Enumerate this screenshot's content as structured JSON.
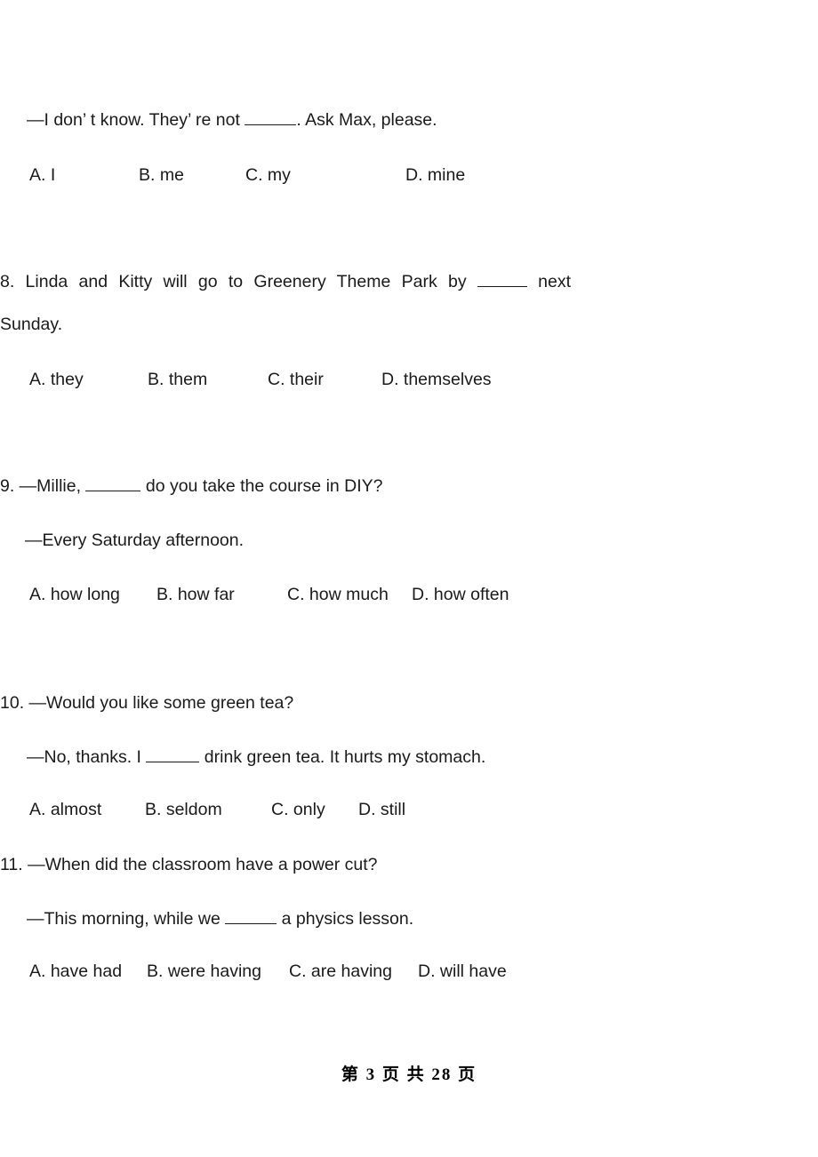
{
  "document": {
    "page_label": "第 3 页 共 28 页",
    "page_number": "3",
    "total_pages": "28",
    "text_color": "#1a1a1a"
  },
  "questions": [
    {
      "id": "q7-continuation",
      "stem_line_1": "—I don’ t know. They’ re not ",
      "stem_line_1_tail": ". Ask Max, please.",
      "options": [
        {
          "key": "A",
          "label": "A. I"
        },
        {
          "key": "B",
          "label": "B. me"
        },
        {
          "key": "C",
          "label": "C. my"
        },
        {
          "key": "D",
          "label": "D. mine"
        }
      ]
    },
    {
      "id": "q8",
      "number": "8.",
      "stem_line_1": "8. Linda and Kitty will go to Greenery Theme Park by ",
      "stem_line_1_tail": " next",
      "stem_line_2": "Sunday.",
      "options": [
        {
          "key": "A",
          "label": "A. they"
        },
        {
          "key": "B",
          "label": "B. them"
        },
        {
          "key": "C",
          "label": "C. their"
        },
        {
          "key": "D",
          "label": "D. themselves"
        }
      ]
    },
    {
      "id": "q9",
      "number": "9.",
      "stem_line_1": "9. —Millie, ",
      "stem_line_1_tail": " do you take the course in DIY?",
      "stem_line_2": "—Every Saturday afternoon.",
      "options": [
        {
          "key": "A",
          "label": "A. how long"
        },
        {
          "key": "B",
          "label": "B. how far"
        },
        {
          "key": "C",
          "label": "C. how much"
        },
        {
          "key": "D",
          "label": "D. how often"
        }
      ]
    },
    {
      "id": "q10",
      "number": "10.",
      "stem_line_1": "10. —Would you like some green tea?",
      "stem_line_2_head": "—No, thanks. I ",
      "stem_line_2_tail": " drink green tea. It hurts my stomach.",
      "options": [
        {
          "key": "A",
          "label": "A. almost"
        },
        {
          "key": "B",
          "label": "B. seldom"
        },
        {
          "key": "C",
          "label": "C. only"
        },
        {
          "key": "D",
          "label": "D. still"
        }
      ]
    },
    {
      "id": "q11",
      "number": "11.",
      "stem_line_1": "11. —When did the classroom have a power cut?",
      "stem_line_2_head": "—This morning, while we ",
      "stem_line_2_tail": " a physics lesson.",
      "options": [
        {
          "key": "A",
          "label": "A. have had"
        },
        {
          "key": "B",
          "label": "B. were having"
        },
        {
          "key": "C",
          "label": "C. are having"
        },
        {
          "key": "D",
          "label": "D. will have"
        }
      ]
    }
  ]
}
